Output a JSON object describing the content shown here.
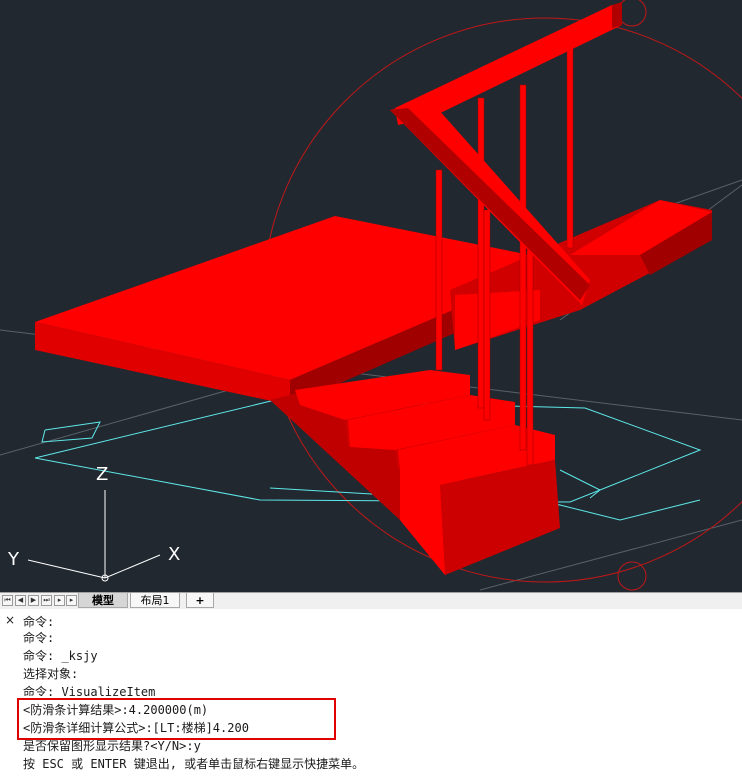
{
  "viewport": {
    "background": "#212830",
    "model_color": "#ff0000",
    "guide_color": "#5ee8e8",
    "axes": {
      "x_label": "X",
      "y_label": "Y",
      "z_label": "Z"
    }
  },
  "tabbar": {
    "nav_icons": [
      "first-icon",
      "prev-icon",
      "next-icon",
      "last-icon"
    ],
    "tabs": [
      {
        "label": "模型",
        "active": true
      },
      {
        "label": "布局1",
        "active": false
      },
      {
        "label": "+",
        "active": false
      }
    ]
  },
  "command": {
    "close_symbol": "×",
    "lines": [
      "命令:",
      "命令:",
      "命令: _ksjy",
      "选择对象:",
      "命令: VisualizeItem",
      "<防滑条计算结果>:4.200000(m)",
      "<防滑条详细计算公式>:[LT:楼梯]4.200",
      "是否保留图形显示结果?<Y/N>:y",
      "按 ESC 或 ENTER 键退出, 或者单击鼠标右键显示快捷菜单。"
    ],
    "highlight_color": "#e00000"
  }
}
